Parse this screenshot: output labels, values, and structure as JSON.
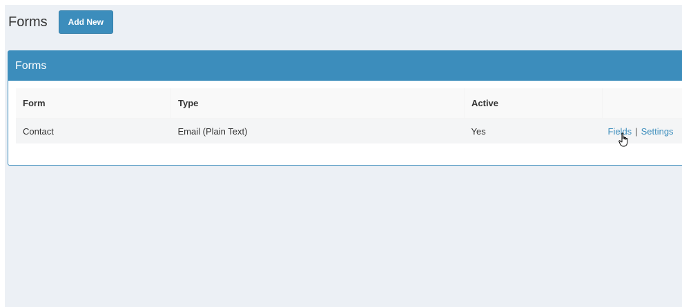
{
  "header": {
    "title": "Forms",
    "add_new_label": "Add New"
  },
  "box": {
    "title": "Forms"
  },
  "table": {
    "columns": [
      "Form",
      "Type",
      "Active",
      ""
    ],
    "rows": [
      {
        "form": "Contact",
        "type": "Email (Plain Text)",
        "active": "Yes",
        "actions": {
          "fields": "Fields",
          "separator": "|",
          "settings": "Settings"
        }
      }
    ]
  },
  "colors": {
    "accent": "#3c8dbc",
    "background": "#ecf0f5"
  },
  "cursor": {
    "icon": "hand-pointer-icon"
  }
}
